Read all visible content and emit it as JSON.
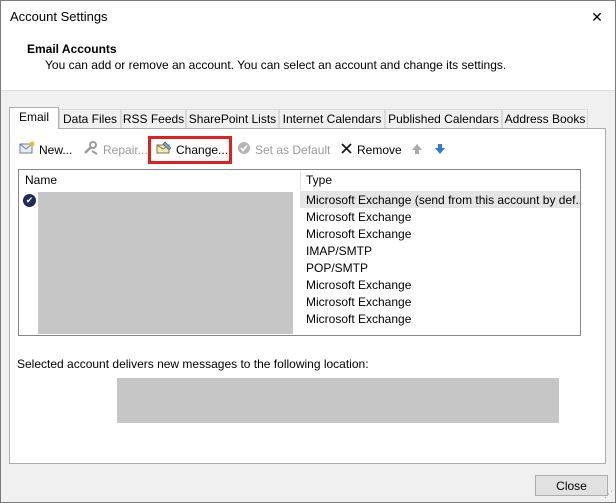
{
  "window": {
    "title": "Account Settings",
    "close_glyph": "✕"
  },
  "header": {
    "title": "Email Accounts",
    "description": "You can add or remove an account. You can select an account and change its settings."
  },
  "tabs": [
    {
      "label": "Email",
      "active": true
    },
    {
      "label": "Data Files"
    },
    {
      "label": "RSS Feeds"
    },
    {
      "label": "SharePoint Lists"
    },
    {
      "label": "Internet Calendars"
    },
    {
      "label": "Published Calendars"
    },
    {
      "label": "Address Books"
    }
  ],
  "toolbar": {
    "new_label": "New...",
    "repair_label": "Repair...",
    "change_label": "Change...",
    "set_default_label": "Set as Default",
    "remove_label": "Remove",
    "highlight_color": "#e02020"
  },
  "accounts": {
    "columns": {
      "name": "Name",
      "type": "Type"
    },
    "rows": [
      {
        "type": "Microsoft Exchange (send from this account by def...",
        "default": true,
        "selected": true
      },
      {
        "type": "Microsoft Exchange"
      },
      {
        "type": "Microsoft Exchange"
      },
      {
        "type": "IMAP/SMTP"
      },
      {
        "type": "POP/SMTP"
      },
      {
        "type": "Microsoft Exchange"
      },
      {
        "type": "Microsoft Exchange"
      },
      {
        "type": "Microsoft Exchange"
      }
    ]
  },
  "delivery": {
    "label": "Selected account delivers new messages to the following location:"
  },
  "footer": {
    "close_label": "Close"
  }
}
